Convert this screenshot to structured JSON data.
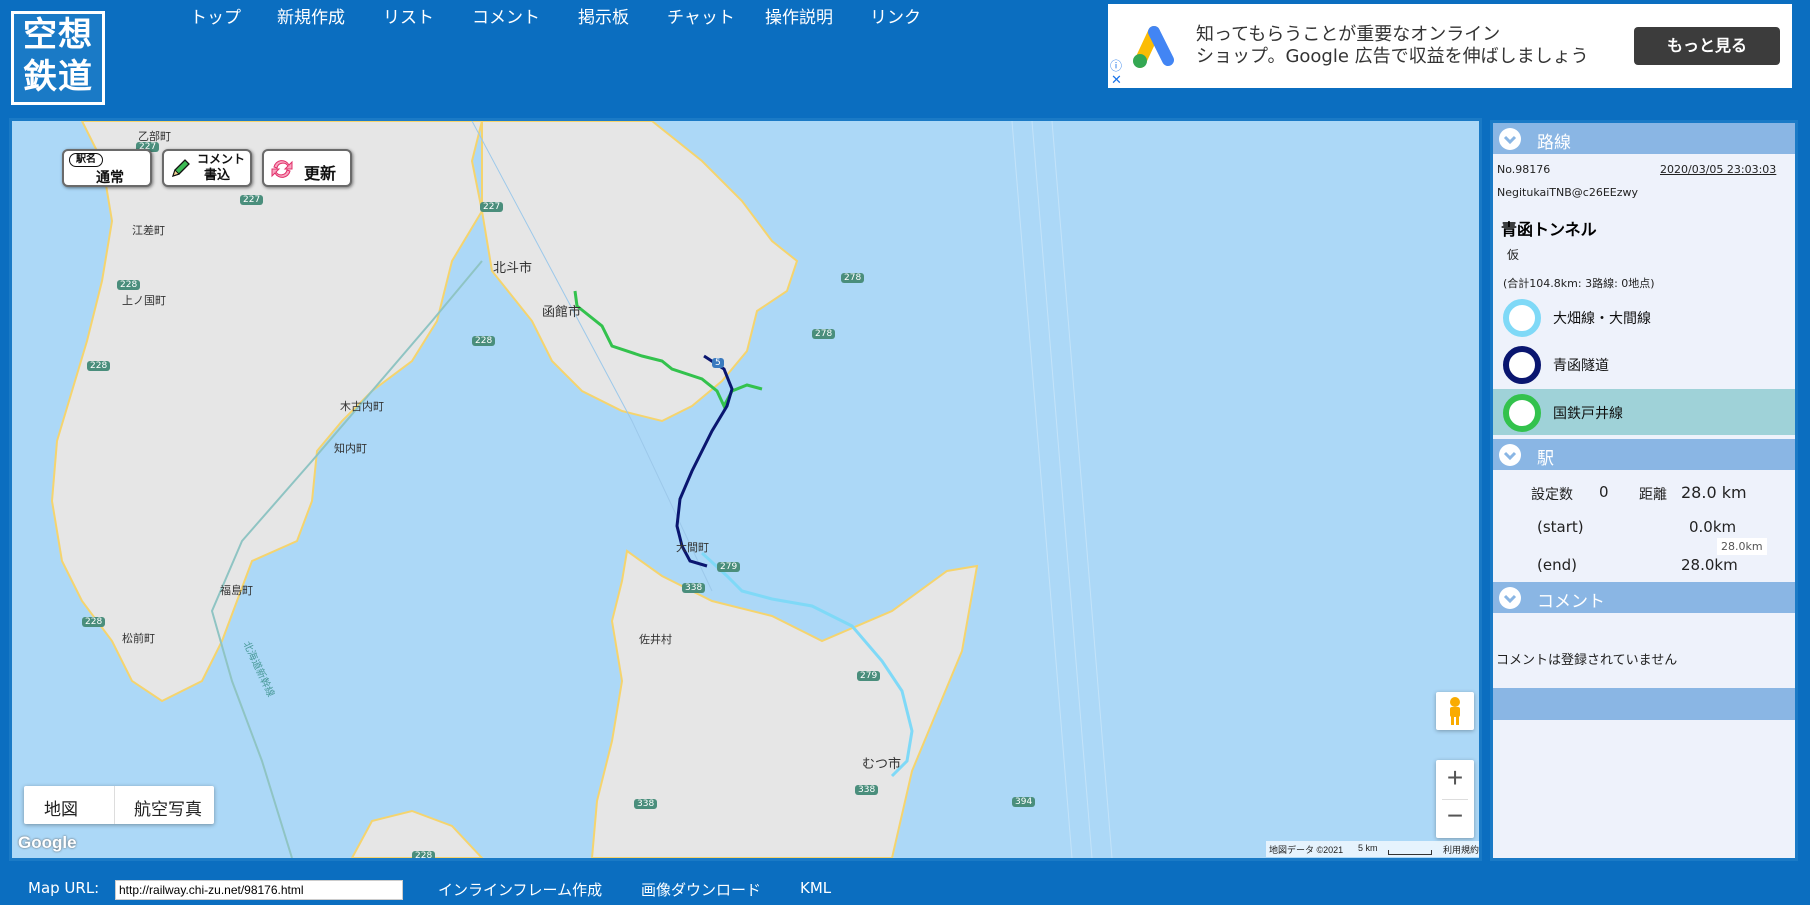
{
  "logo": {
    "line1": "空想",
    "line2": "鉄道"
  },
  "nav": [
    "トップ",
    "新規作成",
    "リスト",
    "コメント",
    "掲示板",
    "チャット",
    "操作説明",
    "リンク"
  ],
  "ad": {
    "line1": "知ってもらうことが重要なオンライン",
    "line2": "ショップ。Google 広告で収益を伸ばしましょう",
    "button": "もっと見る",
    "info_icon": "ⓘ",
    "close_icon": "✕"
  },
  "map": {
    "btn_station_tag": "駅名",
    "btn_station_mode": "通常",
    "btn_comment_1": "コメント",
    "btn_comment_2": "書込",
    "btn_refresh": "更新",
    "maptype_map": "地図",
    "maptype_satellite": "航空写真",
    "zoom_in": "+",
    "zoom_out": "−",
    "google": "Google",
    "attribution": "地図データ ©2021",
    "scale": "5 km",
    "terms": "利用規約",
    "places": {
      "otobe": "乙部町",
      "esashi": "江差町",
      "kaminokuni": "上ノ国町",
      "hokuto": "北斗市",
      "hakodate": "函館市",
      "kikonai": "木古内町",
      "shiriuchi": "知内町",
      "fukushima": "福島町",
      "matsumae": "松前町",
      "oma": "大間町",
      "sai": "佐井村",
      "mutsu": "むつ市",
      "shinkansen": "北海道新幹線"
    },
    "routes": {
      "r227a": "227",
      "r227b": "227",
      "r227c": "227",
      "r228a": "228",
      "r228b": "228",
      "r228c": "228",
      "r228d": "228",
      "r278a": "278",
      "r278b": "278",
      "r279a": "279",
      "r279b": "279",
      "r338a": "338",
      "r338b": "338",
      "r338c": "338",
      "r394": "394",
      "r228e": "228",
      "r5": "5"
    }
  },
  "panel": {
    "route_header": "路線",
    "number": "No.98176",
    "date": "2020/03/05 23:03:03",
    "author": "NegitukaiTNB@c26EEzwy",
    "title": "青函トンネル",
    "subtitle": "仮",
    "summary": "(合計104.8km: 3路線: 0地点)",
    "lines": [
      {
        "name": "大畑線・大間線",
        "color": "#7fd9f7"
      },
      {
        "name": "青函隧道",
        "color": "#0a1670"
      },
      {
        "name": "国鉄戸井線",
        "color": "#33c24d"
      }
    ],
    "station_header": "駅",
    "count_label": "設定数",
    "count_value": "0",
    "distance_label": "距離",
    "distance_value": "28.0 km",
    "start_label": "(start)",
    "start_value": "0.0km",
    "end_label": "(end)",
    "end_value": "28.0km",
    "tooltip": "28.0km",
    "comment_header": "コメント",
    "no_comment": "コメントは登録されていません"
  },
  "bottom": {
    "url_label": "Map URL:",
    "url": "http://railway.chi-zu.net/98176.html",
    "iframe": "インラインフレーム作成",
    "download": "画像ダウンロード",
    "kml": "KML"
  }
}
